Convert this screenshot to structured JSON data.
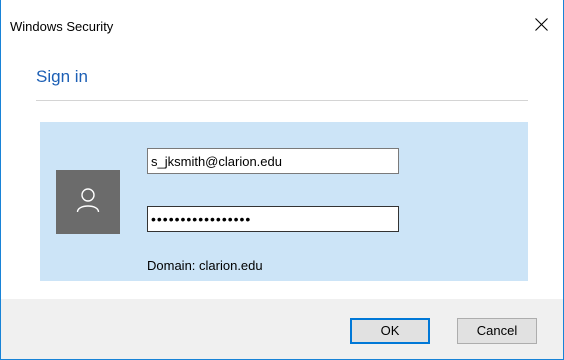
{
  "window": {
    "title": "Windows Security",
    "close_icon": "close-icon"
  },
  "dialog": {
    "heading": "Sign in"
  },
  "credentials": {
    "avatar_icon": "user-icon",
    "username_value": "s_jksmith@clarion.edu",
    "password_masked": "•••••••••••••••••",
    "domain_text": "Domain: clarion.edu"
  },
  "buttons": {
    "ok_label": "OK",
    "cancel_label": "Cancel"
  },
  "colors": {
    "accent": "#0078d7",
    "heading": "#1c5fb5",
    "panel": "#cce4f7",
    "avatar": "#6b6b6b",
    "footer": "#f0f0f0"
  }
}
